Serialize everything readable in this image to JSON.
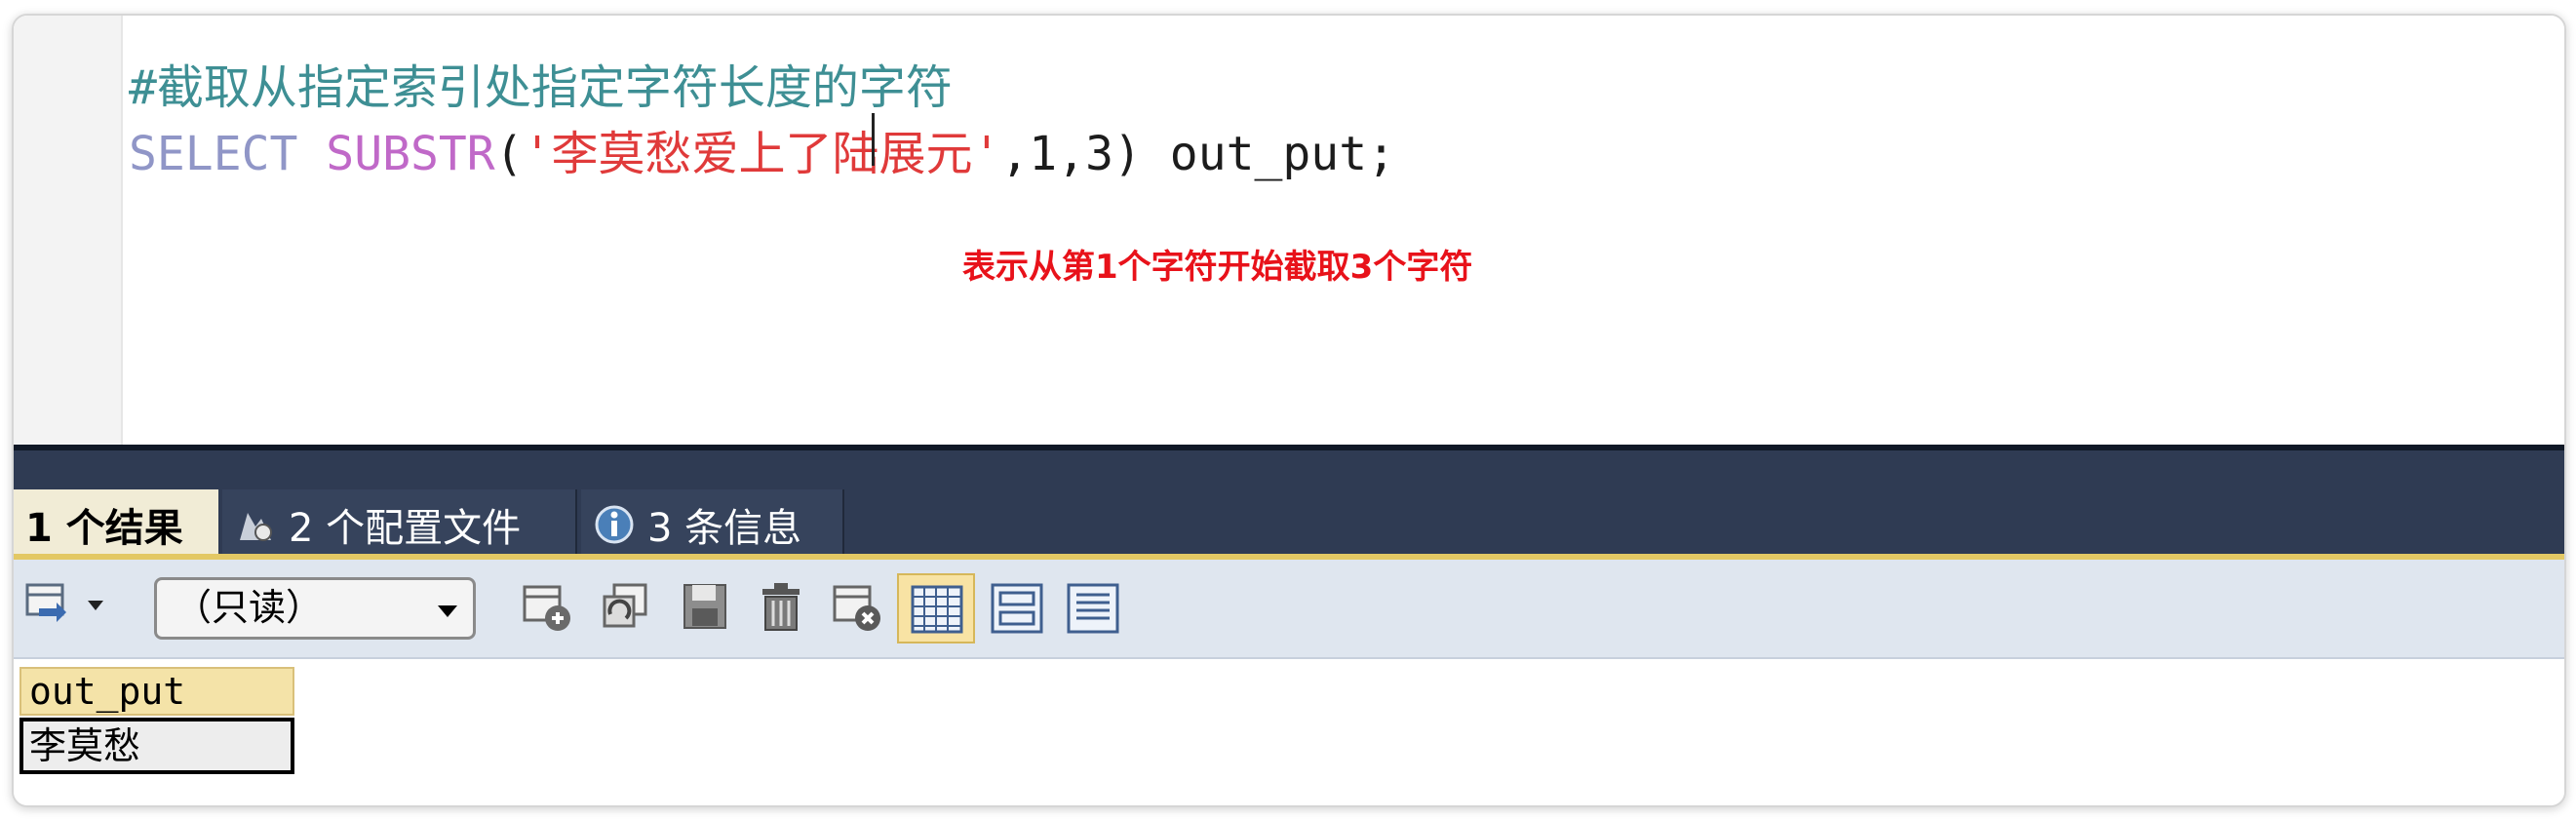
{
  "editor": {
    "comment_line": "#截取从指定索引处指定字符长度的字符",
    "sql": {
      "keyword": "SELECT",
      "function": "SUBSTR",
      "open_paren": "(",
      "string_literal": "'李莫愁爱上了陆展元'",
      "args": ",1,3)",
      "alias": " out_put;"
    }
  },
  "annotation": "表示从第1个字符开始截取3个字符",
  "result_tabs": [
    {
      "label": "1 个结果",
      "icon": "table-icon"
    },
    {
      "label": "2 个配置文件",
      "icon": "profile-icon"
    },
    {
      "label": "3 条信息",
      "icon": "info-icon"
    }
  ],
  "toolbar": {
    "mode_select_value": "（只读）",
    "icons": [
      "export-icon",
      "add-row-icon",
      "duplicate-row-icon",
      "save-icon",
      "delete-icon",
      "cancel-icon",
      "grid-view-icon",
      "form-view-icon",
      "text-view-icon"
    ]
  },
  "results": {
    "columns": [
      "out_put"
    ],
    "rows": [
      [
        "李莫愁"
      ]
    ]
  },
  "colors": {
    "comment": "#3e8f94",
    "keyword": "#9096c7",
    "function": "#c069c8",
    "string": "#e03a3a",
    "annotation": "#e8121a",
    "tab_bar": "#2f3b53",
    "active_tab": "#f1ecd6"
  }
}
